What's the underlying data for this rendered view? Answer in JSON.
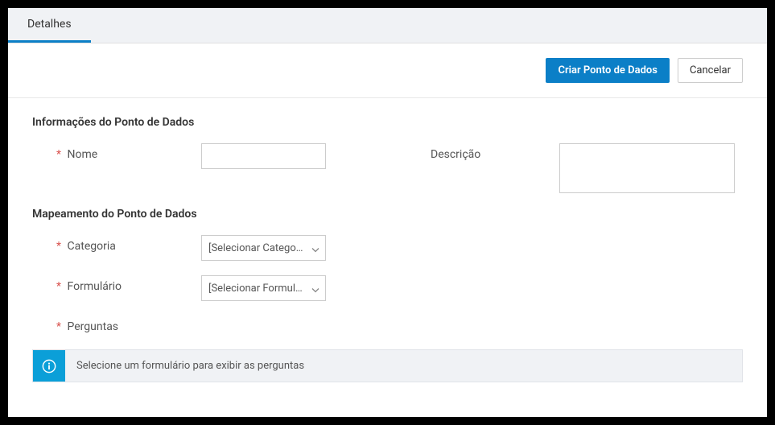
{
  "tabs": {
    "details": "Detalhes"
  },
  "actions": {
    "create": "Criar Ponto de Dados",
    "cancel": "Cancelar"
  },
  "sections": {
    "info_title": "Informações do Ponto de Dados",
    "mapping_title": "Mapeamento do Ponto de Dados"
  },
  "fields": {
    "name_label": "Nome",
    "description_label": "Descrição",
    "category_label": "Categoria",
    "category_placeholder": "[Selecionar Categoria]",
    "form_label": "Formulário",
    "form_placeholder": "[Selecionar Formulário]",
    "questions_label": "Perguntas"
  },
  "banner": {
    "message": "Selecione um formulário para exibir as perguntas"
  },
  "required_mark": "*"
}
